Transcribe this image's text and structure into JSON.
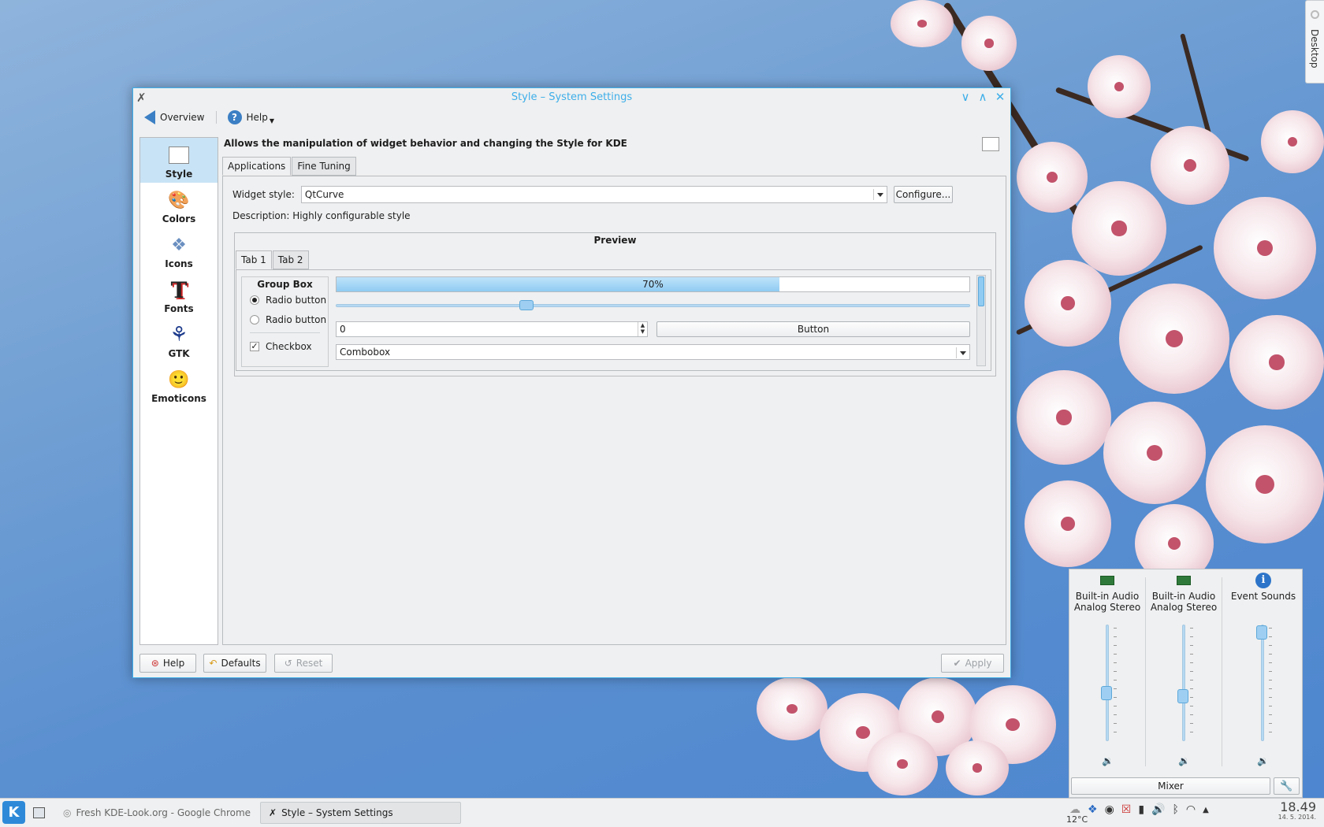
{
  "window": {
    "title": "Style – System Settings",
    "controls": [
      "∨",
      "∧",
      "✕"
    ]
  },
  "toolbar": {
    "overview": "Overview",
    "help": "Help"
  },
  "sidebar": {
    "items": [
      {
        "label": "Style",
        "icon": "▭"
      },
      {
        "label": "Colors",
        "icon": "🎨"
      },
      {
        "label": "Icons",
        "icon": "❖"
      },
      {
        "label": "Fonts",
        "icon": "T"
      },
      {
        "label": "GTK",
        "icon": "⚘"
      },
      {
        "label": "Emoticons",
        "icon": "🙂"
      }
    ]
  },
  "main": {
    "description": "Allows the manipulation of widget behavior and changing the Style for KDE",
    "tabs": [
      "Applications",
      "Fine Tuning"
    ],
    "widget_style_label": "Widget style:",
    "widget_style_value": "QtCurve",
    "configure": "Configure...",
    "description_line": "Description: Highly configurable style"
  },
  "preview": {
    "title": "Preview",
    "tabs": [
      "Tab 1",
      "Tab 2"
    ],
    "group_box": "Group Box",
    "radio1": "Radio button",
    "radio2": "Radio button",
    "checkbox": "Checkbox",
    "checkbox_mark": "✓",
    "progress_text": "70%",
    "progress_value": 0.7,
    "slider_value": 0.3,
    "spin_value": "0",
    "spin_arrows": "▲\n▼",
    "button": "Button",
    "combobox": "Combobox"
  },
  "bottom": {
    "help": "Help",
    "defaults": "Defaults",
    "reset": "Reset",
    "apply": "Apply"
  },
  "mixer": {
    "channels": [
      {
        "line1": "Built-in Audio",
        "line2": "Analog Stereo",
        "level": 0.4
      },
      {
        "line1": "Built-in Audio",
        "line2": "Analog Stereo",
        "level": 0.37
      },
      {
        "line1": "Event Sounds",
        "line2": "",
        "level": 1.0
      }
    ],
    "mixer_button": "Mixer",
    "speaker_icon": "🔉"
  },
  "desktop_tab": "Desktop",
  "taskbar": {
    "kde_label": "K",
    "task1": "Fresh KDE-Look.org - Google Chrome",
    "task2": "Style – System Settings",
    "weather": "12°C",
    "time": "18.49",
    "date": "14. 5. 2014."
  }
}
